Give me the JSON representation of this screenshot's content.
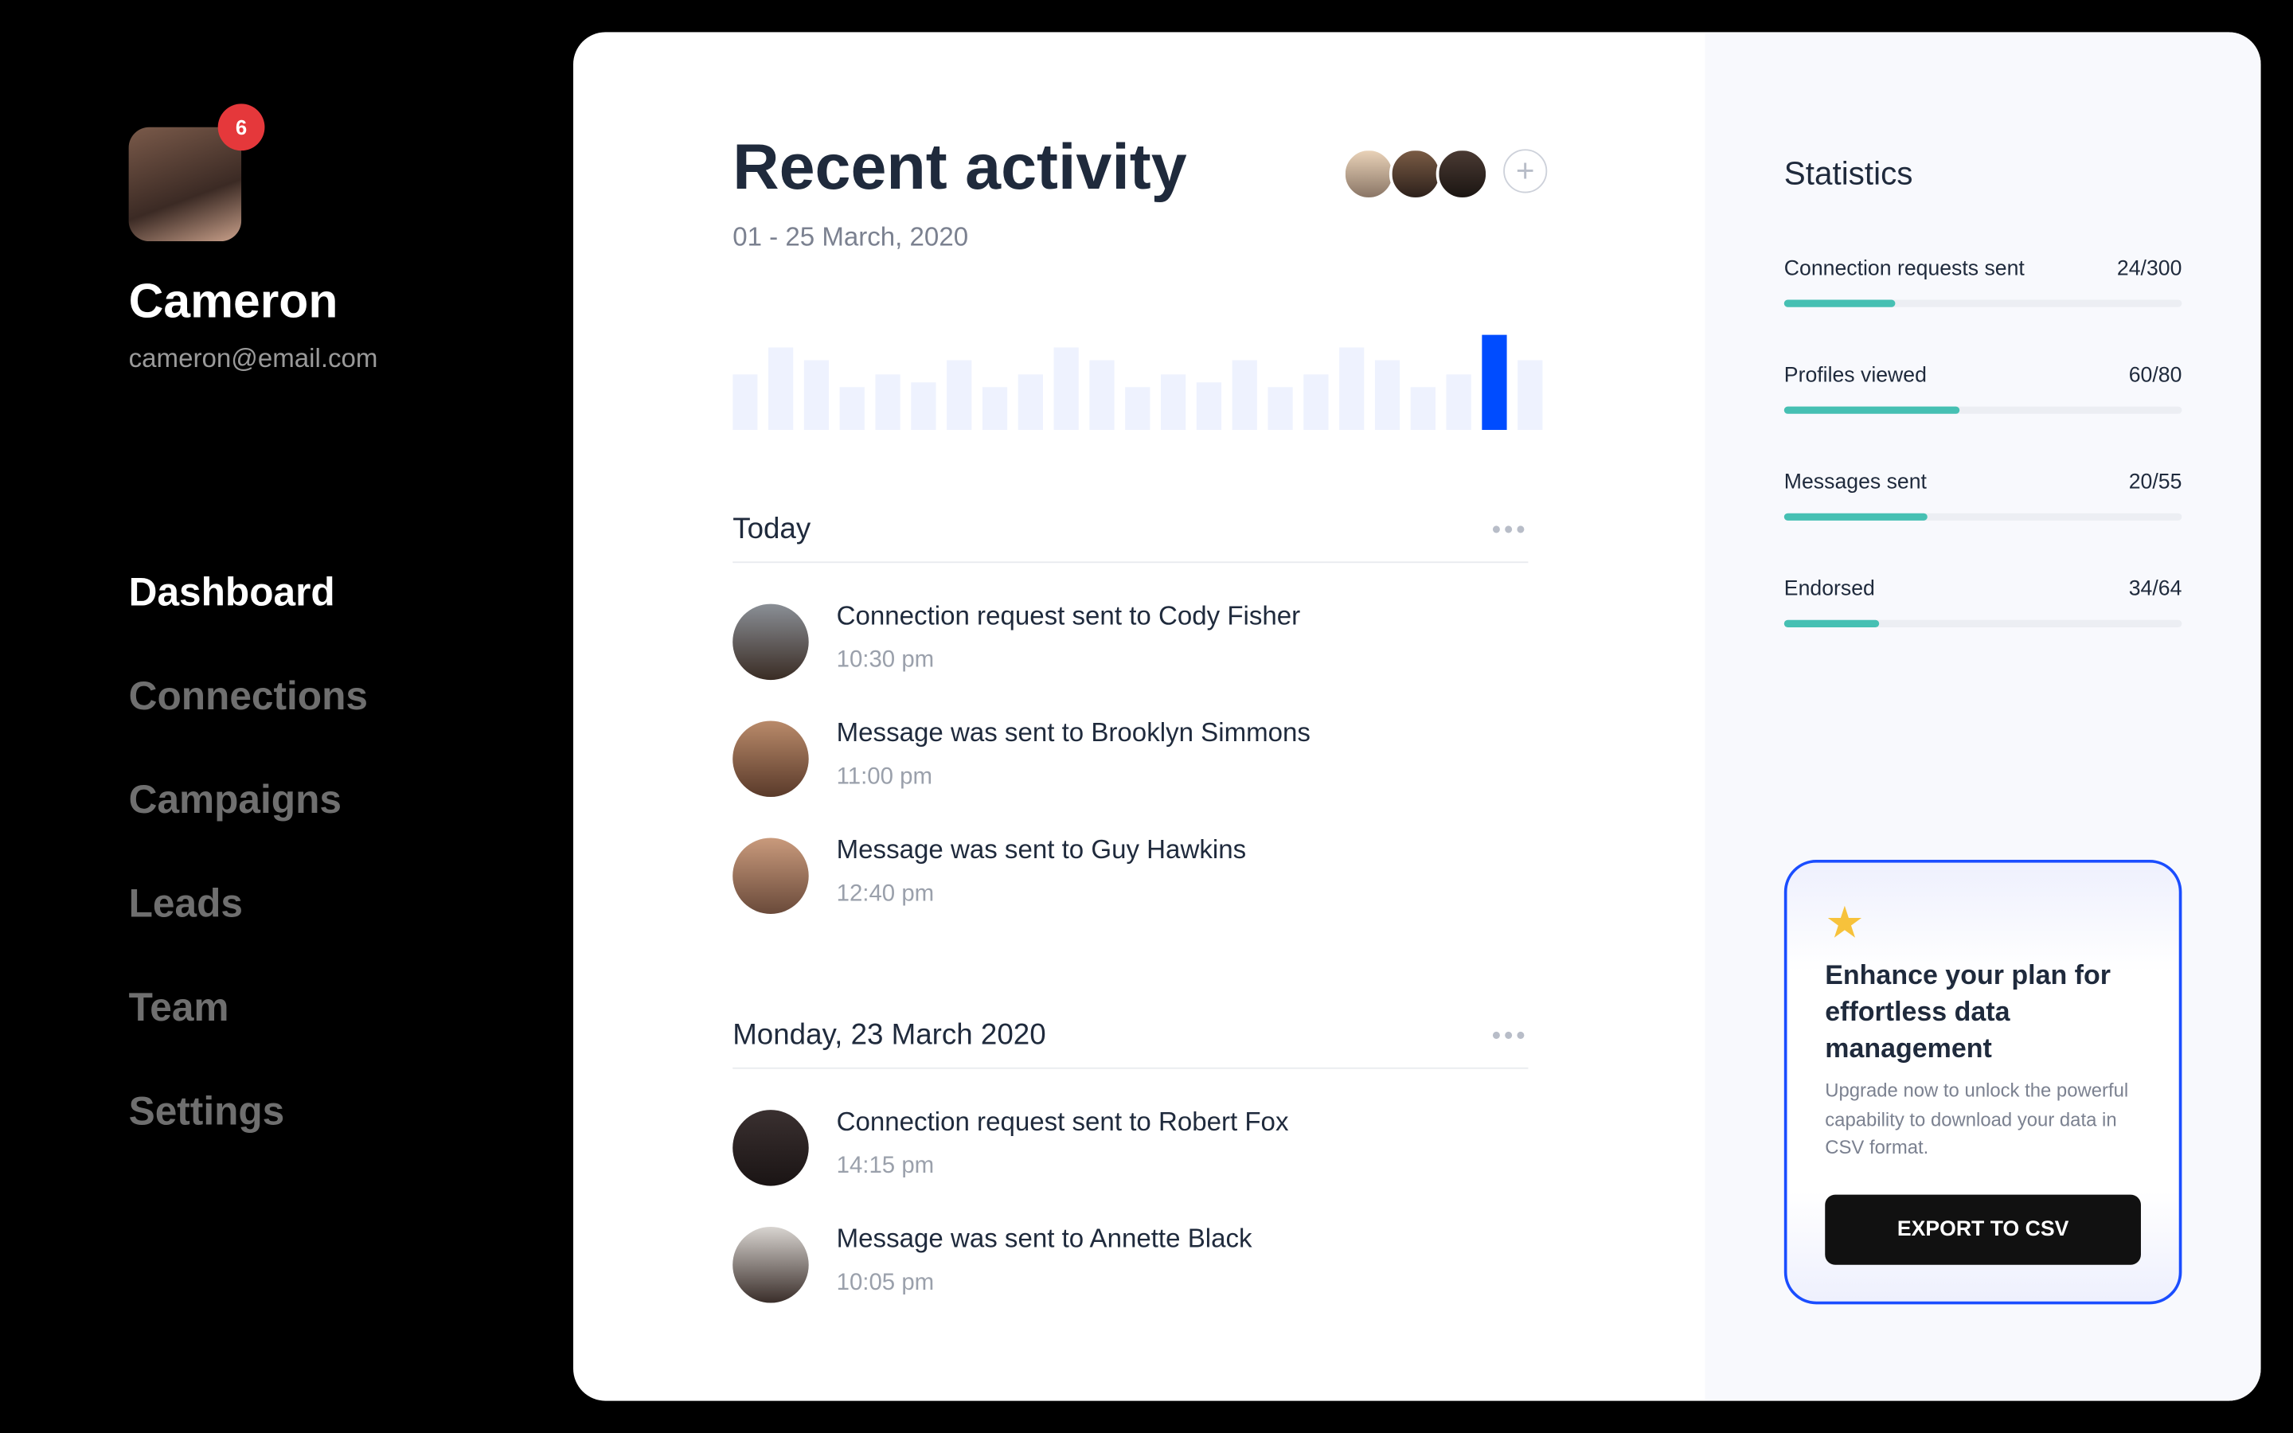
{
  "user": {
    "name": "Cameron",
    "email": "cameron@email.com",
    "notifications": "6"
  },
  "nav": [
    {
      "label": "Dashboard",
      "active": true
    },
    {
      "label": "Connections"
    },
    {
      "label": "Campaigns"
    },
    {
      "label": "Leads"
    },
    {
      "label": "Team"
    },
    {
      "label": "Settings"
    }
  ],
  "activity": {
    "title": "Recent activity",
    "date_range": "01 - 25 March, 2020",
    "add_icon": "plus-circle-icon",
    "more_icon": "ellipsis-icon",
    "sections": [
      {
        "heading": "Today",
        "items": [
          {
            "text": "Connection request sent to Cody Fisher",
            "time": "10:30 pm"
          },
          {
            "text": "Message was sent to Brooklyn Simmons",
            "time": "11:00 pm"
          },
          {
            "text": "Message was sent to Guy Hawkins",
            "time": "12:40 pm"
          }
        ]
      },
      {
        "heading": "Monday, 23 March 2020",
        "items": [
          {
            "text": "Connection request sent to Robert Fox",
            "time": "14:15 pm"
          },
          {
            "text": "Message was sent to Annette Black",
            "time": "10:05 pm"
          }
        ]
      }
    ]
  },
  "chart_data": {
    "type": "bar",
    "values": [
      210,
      312,
      264,
      162,
      210,
      180,
      264,
      162,
      210,
      312,
      264,
      162,
      210,
      180,
      264,
      162,
      210,
      312,
      264,
      162,
      210,
      360,
      264
    ],
    "highlight_index": 21,
    "colors": {
      "bar": "#eef2fe",
      "highlight": "#004cff"
    },
    "grid": false
  },
  "statistics": {
    "title": "Statistics",
    "items": [
      {
        "label": "Connection requests sent",
        "value": "24/300",
        "fill": 0.28
      },
      {
        "label": "Profiles viewed",
        "value": "60/80",
        "fill": 0.44
      },
      {
        "label": "Messages sent",
        "value": "20/55",
        "fill": 0.36
      },
      {
        "label": "Endorsed",
        "value": "34/64",
        "fill": 0.24
      }
    ],
    "bar_color": "#46c0b3"
  },
  "promo": {
    "icon": "star-icon",
    "heading": "Enhance your plan for effortless data management",
    "description": "Upgrade now to unlock the powerful capability to download your data in CSV format.",
    "button": "EXPORT TO CSV",
    "accent": "#1a4dff"
  }
}
